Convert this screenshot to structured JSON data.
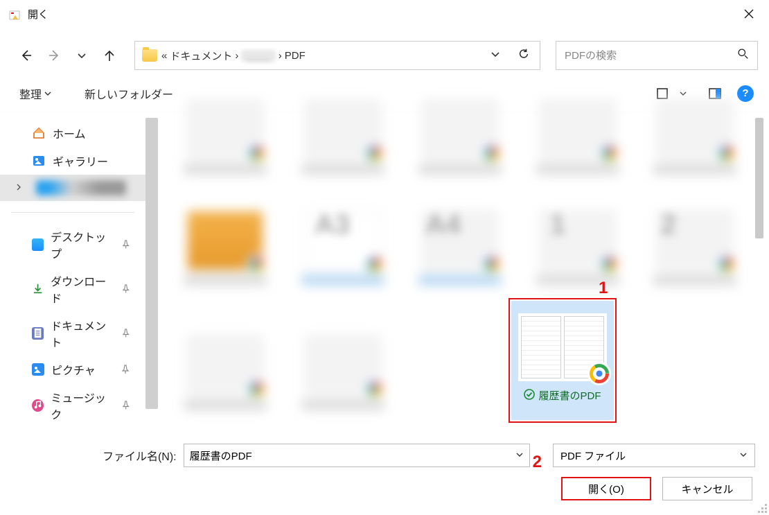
{
  "window": {
    "title": "開く"
  },
  "nav": {},
  "address": {
    "trail_sep_pre": "«",
    "trail_1": "ドキュメント",
    "trail_sep": "›",
    "trail_blur": "____",
    "trail_2": "PDF"
  },
  "search": {
    "placeholder": "PDFの検索"
  },
  "toolbar": {
    "organize": "整理",
    "newfolder": "新しいフォルダー"
  },
  "sidebar": {
    "home": "ホーム",
    "gallery": "ギャラリー",
    "desktop": "デスクトップ",
    "downloads": "ダウンロード",
    "documents": "ドキュメント",
    "pictures": "ピクチャ",
    "music": "ミュージック"
  },
  "grid": {
    "bigtexts": [
      "A3",
      "A4",
      "1",
      "2"
    ],
    "selected_label": "履歴書のPDF"
  },
  "annotations": {
    "a1": "1",
    "a2": "2"
  },
  "footer": {
    "filename_label": "ファイル名(N):",
    "filename_value": "履歴書のPDF",
    "filetype_value": "PDF ファイル",
    "open_btn": "開く(O)",
    "cancel_btn": "キャンセル"
  }
}
